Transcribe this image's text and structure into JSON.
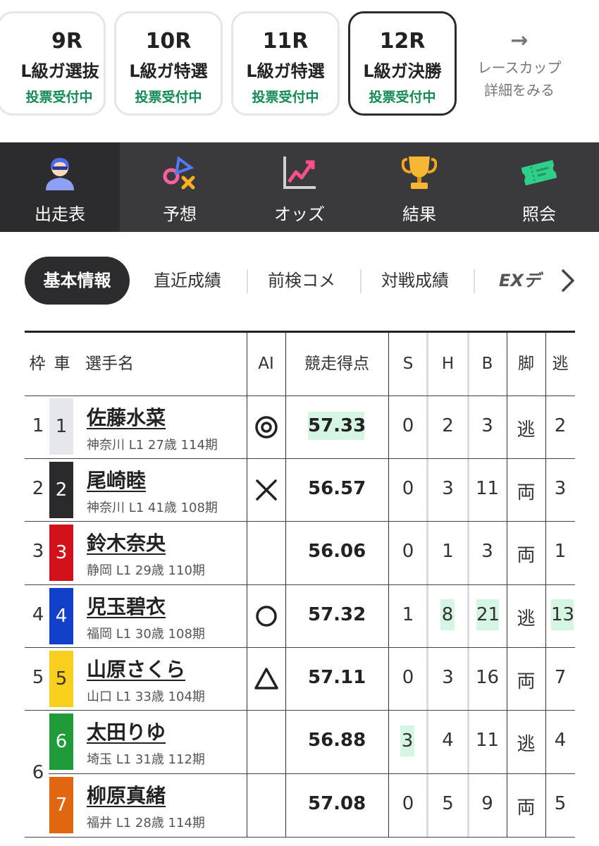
{
  "races": [
    {
      "num": "9R",
      "name": "L級ガ選抜",
      "status": "投票受付中",
      "active": false
    },
    {
      "num": "10R",
      "name": "L級ガ特選",
      "status": "投票受付中",
      "active": false
    },
    {
      "num": "11R",
      "name": "L級ガ特選",
      "status": "投票受付中",
      "active": false
    },
    {
      "num": "12R",
      "name": "L級ガ決勝",
      "status": "投票受付中",
      "active": true
    }
  ],
  "race_more": {
    "line1": "レースカップ",
    "line2": "詳細をみる"
  },
  "nav": [
    {
      "label": "出走表",
      "icon": "rider-icon",
      "active": true
    },
    {
      "label": "予想",
      "icon": "prediction-symbols-icon",
      "active": false
    },
    {
      "label": "オッズ",
      "icon": "odds-chart-icon",
      "active": false
    },
    {
      "label": "結果",
      "icon": "trophy-icon",
      "active": false
    },
    {
      "label": "照会",
      "icon": "ticket-icon",
      "active": false
    }
  ],
  "tabs": [
    {
      "label": "基本情報",
      "active": true
    },
    {
      "label": "直近成績",
      "active": false
    },
    {
      "label": "前検コメ",
      "active": false
    },
    {
      "label": "対戦成績",
      "active": false
    },
    {
      "label": "EXデ",
      "active": false
    }
  ],
  "table": {
    "headers": {
      "frame": "枠",
      "car": "車",
      "rider": "選手名",
      "ai": "AI",
      "score": "競走得点",
      "s": "S",
      "h": "H",
      "b": "B",
      "style": "脚",
      "nige": "逃"
    },
    "rows": [
      {
        "frame": "1",
        "car": "1",
        "name": "佐藤水菜",
        "info": "神奈川 L1 27歳 114期",
        "ai": "double-circle",
        "score": "57.33",
        "s": "0",
        "h": "2",
        "b": "3",
        "style": "逃",
        "nige": "2",
        "car_bg": "#e6e7ec",
        "car_fg": "#333333"
      },
      {
        "frame": "2",
        "car": "2",
        "name": "尾崎睦",
        "info": "神奈川 L1 41歳 108期",
        "ai": "cross",
        "score": "56.57",
        "s": "0",
        "h": "3",
        "b": "11",
        "style": "両",
        "nige": "3",
        "car_bg": "#2a2a2c",
        "car_fg": "#ffffff"
      },
      {
        "frame": "3",
        "car": "3",
        "name": "鈴木奈央",
        "info": "静岡 L1 29歳 110期",
        "ai": "",
        "score": "56.06",
        "s": "0",
        "h": "1",
        "b": "3",
        "style": "両",
        "nige": "1",
        "car_bg": "#d0121b",
        "car_fg": "#ffffff"
      },
      {
        "frame": "4",
        "car": "4",
        "name": "児玉碧衣",
        "info": "福岡 L1 30歳 108期",
        "ai": "circle",
        "score": "57.32",
        "s": "1",
        "h": "8",
        "b": "21",
        "style": "逃",
        "nige": "13",
        "car_bg": "#1240c8",
        "car_fg": "#ffffff"
      },
      {
        "frame": "5",
        "car": "5",
        "name": "山原さくら",
        "info": "山口 L1 33歳 104期",
        "ai": "triangle",
        "score": "57.11",
        "s": "0",
        "h": "3",
        "b": "16",
        "style": "両",
        "nige": "7",
        "car_bg": "#f9cf1e",
        "car_fg": "#333333"
      },
      {
        "frame": "6",
        "car": "6",
        "name": "太田りゆ",
        "info": "埼玉 L1 31歳 112期",
        "ai": "",
        "score": "56.88",
        "s": "3",
        "h": "4",
        "b": "11",
        "style": "逃",
        "nige": "4",
        "car_bg": "#1f9b3a",
        "car_fg": "#ffffff"
      },
      {
        "frame": "",
        "car": "7",
        "name": "柳原真緒",
        "info": "福井 L1 28歳 114期",
        "ai": "",
        "score": "57.08",
        "s": "0",
        "h": "5",
        "b": "9",
        "style": "両",
        "nige": "5",
        "car_bg": "#e0660f",
        "car_fg": "#ffffff"
      }
    ]
  },
  "colors": {
    "accent_green": "#138a54",
    "highlight": "#d6f6e4",
    "nav_bg": "#3a3a3c",
    "nav_active": "#2c2c2e"
  }
}
